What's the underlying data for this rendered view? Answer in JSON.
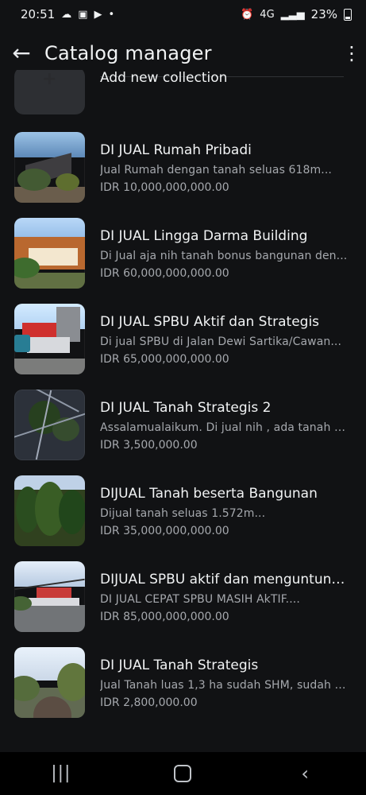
{
  "status_bar": {
    "time": "20:51",
    "battery": "23%",
    "network": "4G"
  },
  "app_bar": {
    "title": "Catalog manager"
  },
  "add_collection": {
    "label": "Add new collection"
  },
  "items": [
    {
      "title": "DI JUAL  Rumah Pribadi",
      "description": "Jual Rumah dengan tanah seluas 618m...",
      "price": "IDR 10,000,000,000.00"
    },
    {
      "title": "DI JUAL  Lingga Darma Building",
      "description": "Di Jual aja nih tanah bonus bangunan den...",
      "price": "IDR 60,000,000,000.00"
    },
    {
      "title": "DI JUAL  SPBU Aktif dan Strategis",
      "description": "Di jual SPBU di Jalan Dewi Sartika/Cawan...",
      "price": "IDR 65,000,000,000.00"
    },
    {
      "title": "DI JUAL Tanah Strategis 2",
      "description": "Assalamualaikum. Di jual nih , ada tanah d...",
      "price": "IDR 3,500,000.00"
    },
    {
      "title": "DIJUAL Tanah beserta Bangunan",
      "description": "Dijual tanah seluas 1.572m...",
      "price": "IDR 35,000,000,000.00"
    },
    {
      "title": "DIJUAL SPBU aktif dan menguntungk...",
      "description": "DI JUAL CEPAT SPBU MASIH AkTIF....",
      "price": "IDR 85,000,000,000.00"
    },
    {
      "title": "DI JUAL Tanah Strategis",
      "description": "Jual Tanah luas 1,3 ha sudah SHM, sudah d...",
      "price": "IDR 2,800,000.00"
    }
  ]
}
